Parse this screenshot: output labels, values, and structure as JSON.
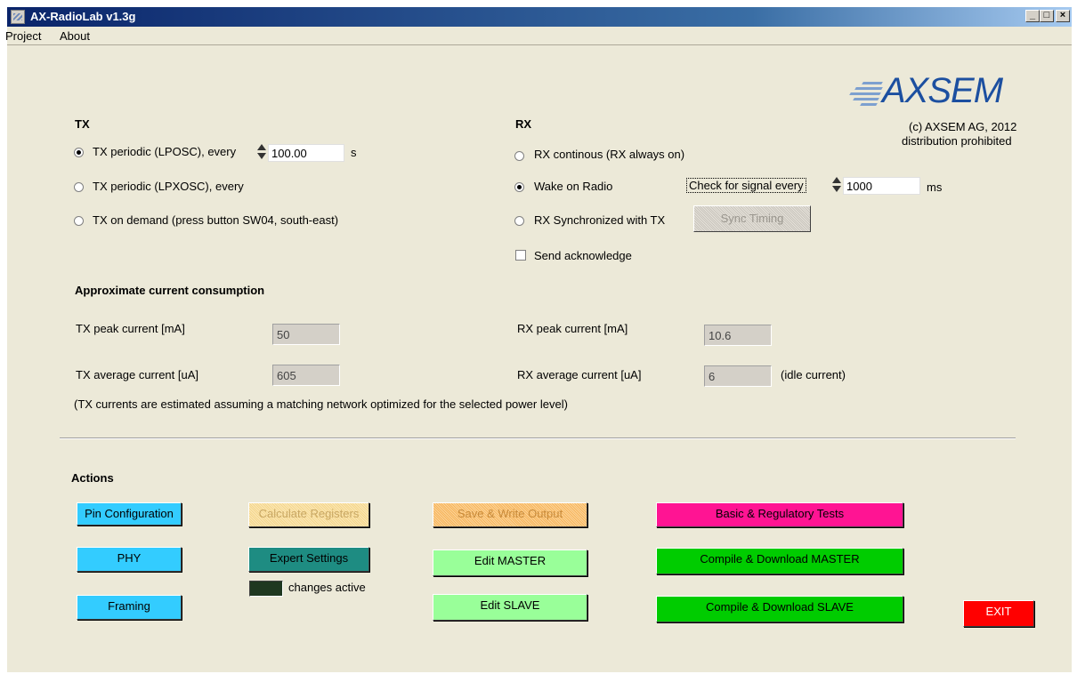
{
  "window": {
    "title": "AX-RadioLab v1.3g",
    "min_label": "_",
    "max_label": "□",
    "close_label": "×"
  },
  "menu": {
    "items": [
      "Project",
      "About"
    ]
  },
  "brand": {
    "logo": "AXSEM",
    "copyright": "(c) AXSEM AG, 2012",
    "notice": "distribution prohibited"
  },
  "tx": {
    "title": "TX",
    "options": [
      {
        "label": "TX periodic (LPOSC), every",
        "selected": true
      },
      {
        "label": "TX periodic (LPXOSC), every",
        "selected": false
      },
      {
        "label": "TX on demand (press button SW04, south-east)",
        "selected": false
      }
    ],
    "period_value": "100.00",
    "period_unit": "s"
  },
  "rx": {
    "title": "RX",
    "options": [
      {
        "label": "RX continous (RX always on)",
        "selected": false
      },
      {
        "label": "Wake on Radio",
        "selected": true
      },
      {
        "label": "RX Synchronized with TX",
        "selected": false
      }
    ],
    "check_label": "Check for signal every",
    "check_value": "1000",
    "check_unit": "ms",
    "sync_button": "Sync Timing",
    "ack_label": "Send acknowledge",
    "ack_checked": false
  },
  "consumption": {
    "title": "Approximate current consumption",
    "tx_peak_label": "TX peak current [mA]",
    "tx_peak_value": "50",
    "tx_avg_label": "TX average current [uA]",
    "tx_avg_value": "605",
    "rx_peak_label": "RX peak current [mA]",
    "rx_peak_value": "10.6",
    "rx_avg_label": "RX average current [uA]",
    "rx_avg_value": "6",
    "rx_idle_note": "(idle current)",
    "note": "(TX currents are estimated assuming a matching network optimized for the selected power level)"
  },
  "actions": {
    "title": "Actions",
    "pin_config": "Pin Configuration",
    "phy": "PHY",
    "framing": "Framing",
    "calc_registers": "Calculate Registers",
    "expert_settings": "Expert Settings",
    "changes_active": "changes active",
    "save_write": "Save & Write Output",
    "edit_master": "Edit MASTER",
    "edit_slave": "Edit SLAVE",
    "basic_tests": "Basic & Regulatory Tests",
    "compile_master": "Compile & Download MASTER",
    "compile_slave": "Compile & Download SLAVE",
    "exit": "EXIT"
  },
  "colors": {
    "title_gradient_start": "#0a246a",
    "button_blue": "#33ccff",
    "button_teal": "#1e8c82",
    "button_light_green": "#99ff99",
    "button_green": "#00cc00",
    "button_magenta": "#ff1493",
    "button_red": "#ff0000",
    "logo_blue": "#1c4fa0"
  }
}
